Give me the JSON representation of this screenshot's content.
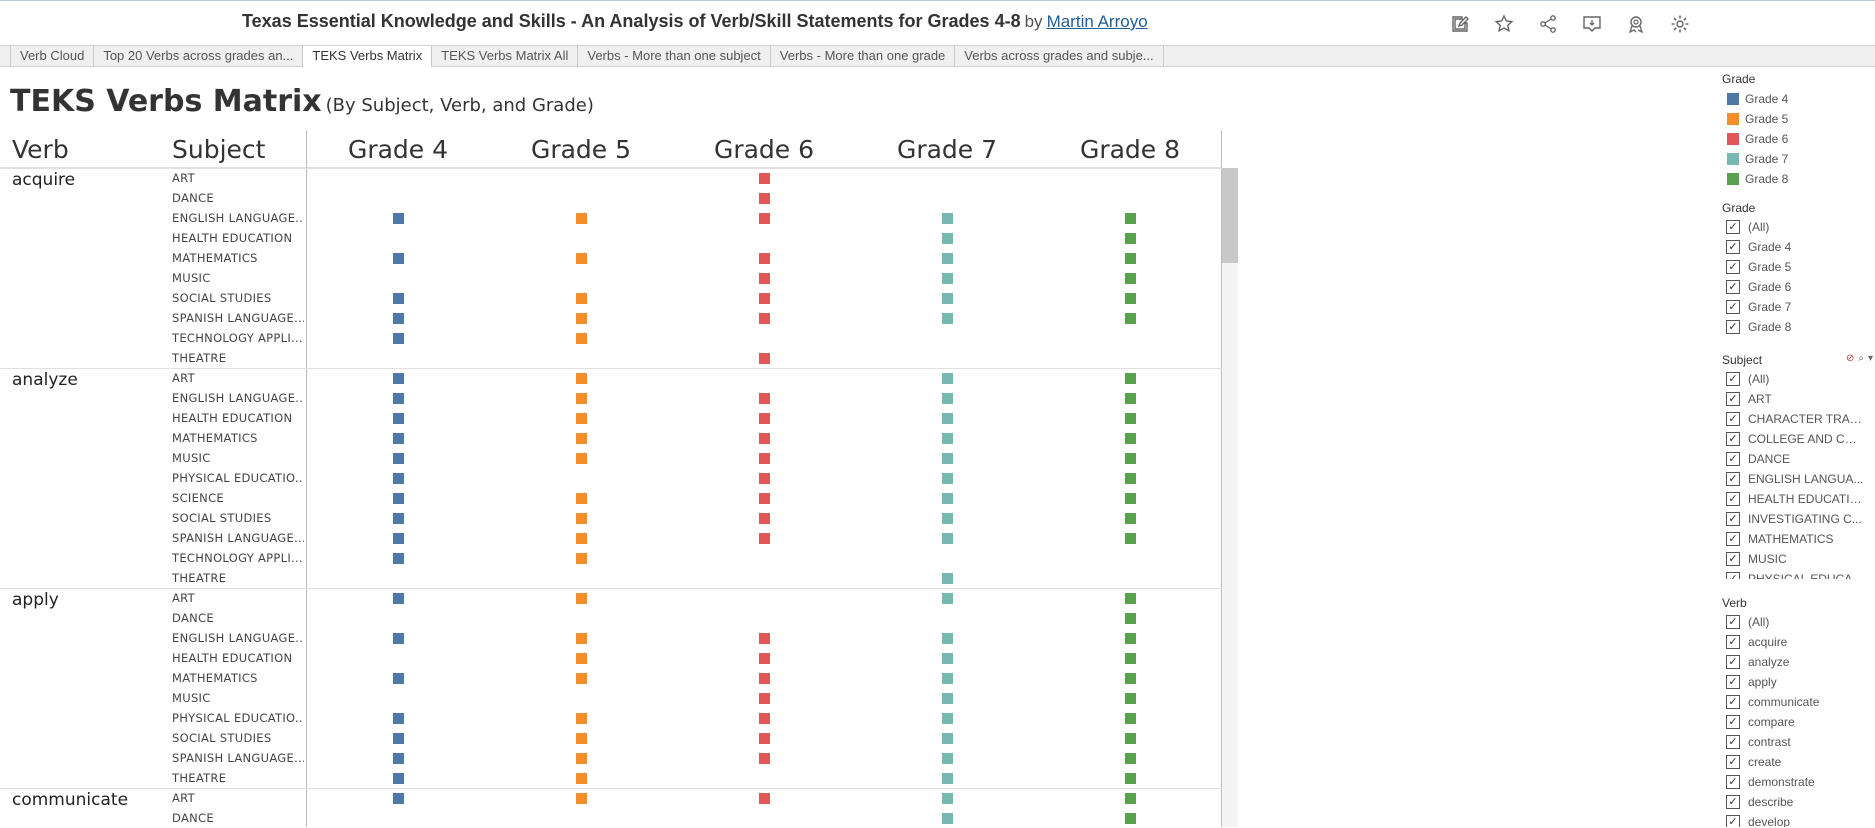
{
  "header": {
    "title": "Texas Essential Knowledge and Skills - An Analysis of Verb/Skill Statements for Grades 4-8",
    "by": "by",
    "author": "Martin Arroyo",
    "toolbar_icons": [
      "edit-icon",
      "star-icon",
      "share-icon",
      "comment-icon",
      "metrics-icon",
      "settings-icon"
    ]
  },
  "tabs": [
    {
      "label": "Verb Cloud",
      "active": false
    },
    {
      "label": "Top 20 Verbs across grades an...",
      "active": false
    },
    {
      "label": "TEKS Verbs Matrix",
      "active": true
    },
    {
      "label": "TEKS Verbs Matrix All",
      "active": false
    },
    {
      "label": "Verbs - More than one subject",
      "active": false
    },
    {
      "label": "Verbs - More than one grade",
      "active": false
    },
    {
      "label": "Verbs across grades and subje...",
      "active": false
    }
  ],
  "sheet": {
    "title": "TEKS Verbs Matrix",
    "subtitle": "(By Subject, Verb, and Grade)"
  },
  "matrix": {
    "col_verb": "Verb",
    "col_subject": "Subject",
    "grades": [
      "Grade 4",
      "Grade 5",
      "Grade 6",
      "Grade 7",
      "Grade 8"
    ],
    "colors": [
      "#4e79a7",
      "#f28e2b",
      "#e15759",
      "#76b7b2",
      "#59a14f"
    ]
  },
  "chart_data": {
    "type": "table",
    "columns": [
      "Grade 4",
      "Grade 5",
      "Grade 6",
      "Grade 7",
      "Grade 8"
    ],
    "groups": [
      {
        "verb": "acquire",
        "rows": [
          {
            "subject": "ART",
            "grades": [
              0,
              0,
              1,
              0,
              0
            ]
          },
          {
            "subject": "DANCE",
            "grades": [
              0,
              0,
              1,
              0,
              0
            ]
          },
          {
            "subject": "ENGLISH LANGUAGE...",
            "grades": [
              1,
              1,
              1,
              1,
              1
            ]
          },
          {
            "subject": "HEALTH EDUCATION",
            "grades": [
              0,
              0,
              0,
              1,
              1
            ]
          },
          {
            "subject": "MATHEMATICS",
            "grades": [
              1,
              1,
              1,
              1,
              1
            ]
          },
          {
            "subject": "MUSIC",
            "grades": [
              0,
              0,
              1,
              1,
              1
            ]
          },
          {
            "subject": "SOCIAL STUDIES",
            "grades": [
              1,
              1,
              1,
              1,
              1
            ]
          },
          {
            "subject": "SPANISH LANGUAGE...",
            "grades": [
              1,
              1,
              1,
              1,
              1
            ]
          },
          {
            "subject": "TECHNOLOGY APPLI...",
            "grades": [
              1,
              1,
              0,
              0,
              0
            ]
          },
          {
            "subject": "THEATRE",
            "grades": [
              0,
              0,
              1,
              0,
              0
            ]
          }
        ]
      },
      {
        "verb": "analyze",
        "rows": [
          {
            "subject": "ART",
            "grades": [
              1,
              1,
              0,
              1,
              1
            ]
          },
          {
            "subject": "ENGLISH LANGUAGE...",
            "grades": [
              1,
              1,
              1,
              1,
              1
            ]
          },
          {
            "subject": "HEALTH EDUCATION",
            "grades": [
              1,
              1,
              1,
              1,
              1
            ]
          },
          {
            "subject": "MATHEMATICS",
            "grades": [
              1,
              1,
              1,
              1,
              1
            ]
          },
          {
            "subject": "MUSIC",
            "grades": [
              1,
              1,
              1,
              1,
              1
            ]
          },
          {
            "subject": "PHYSICAL EDUCATIO...",
            "grades": [
              1,
              0,
              1,
              1,
              1
            ]
          },
          {
            "subject": "SCIENCE",
            "grades": [
              1,
              1,
              1,
              1,
              1
            ]
          },
          {
            "subject": "SOCIAL STUDIES",
            "grades": [
              1,
              1,
              1,
              1,
              1
            ]
          },
          {
            "subject": "SPANISH LANGUAGE...",
            "grades": [
              1,
              1,
              1,
              1,
              1
            ]
          },
          {
            "subject": "TECHNOLOGY APPLI...",
            "grades": [
              1,
              1,
              0,
              0,
              0
            ]
          },
          {
            "subject": "THEATRE",
            "grades": [
              0,
              0,
              0,
              1,
              0
            ]
          }
        ]
      },
      {
        "verb": "apply",
        "rows": [
          {
            "subject": "ART",
            "grades": [
              1,
              1,
              0,
              1,
              1
            ]
          },
          {
            "subject": "DANCE",
            "grades": [
              0,
              0,
              0,
              0,
              1
            ]
          },
          {
            "subject": "ENGLISH LANGUAGE...",
            "grades": [
              1,
              1,
              1,
              1,
              1
            ]
          },
          {
            "subject": "HEALTH EDUCATION",
            "grades": [
              0,
              1,
              1,
              1,
              1
            ]
          },
          {
            "subject": "MATHEMATICS",
            "grades": [
              1,
              1,
              1,
              1,
              1
            ]
          },
          {
            "subject": "MUSIC",
            "grades": [
              0,
              0,
              1,
              1,
              1
            ]
          },
          {
            "subject": "PHYSICAL EDUCATIO...",
            "grades": [
              1,
              1,
              1,
              1,
              1
            ]
          },
          {
            "subject": "SOCIAL STUDIES",
            "grades": [
              1,
              1,
              1,
              1,
              1
            ]
          },
          {
            "subject": "SPANISH LANGUAGE...",
            "grades": [
              1,
              1,
              1,
              1,
              1
            ]
          },
          {
            "subject": "THEATRE",
            "grades": [
              1,
              1,
              0,
              1,
              1
            ]
          }
        ]
      },
      {
        "verb": "communicate",
        "rows": [
          {
            "subject": "ART",
            "grades": [
              1,
              1,
              1,
              1,
              1
            ]
          },
          {
            "subject": "DANCE",
            "grades": [
              0,
              0,
              0,
              1,
              1
            ]
          }
        ]
      }
    ]
  },
  "legend": {
    "title": "Grade",
    "items": [
      "Grade 4",
      "Grade 5",
      "Grade 6",
      "Grade 7",
      "Grade 8"
    ]
  },
  "filters": {
    "grade": {
      "title": "Grade",
      "items": [
        "(All)",
        "Grade 4",
        "Grade 5",
        "Grade 6",
        "Grade 7",
        "Grade 8"
      ]
    },
    "subject": {
      "title": "Subject",
      "items": [
        "(All)",
        "ART",
        "CHARACTER TRAITS",
        "COLLEGE AND CAR...",
        "DANCE",
        "ENGLISH LANGUA...",
        "HEALTH EDUCATION",
        "INVESTIGATING C...",
        "MATHEMATICS",
        "MUSIC",
        "PHYSICAL EDUCAT..."
      ]
    },
    "verb": {
      "title": "Verb",
      "items": [
        "(All)",
        "acquire",
        "analyze",
        "apply",
        "communicate",
        "compare",
        "contrast",
        "create",
        "demonstrate",
        "describe",
        "develop"
      ]
    },
    "check_glyph": "✓"
  }
}
